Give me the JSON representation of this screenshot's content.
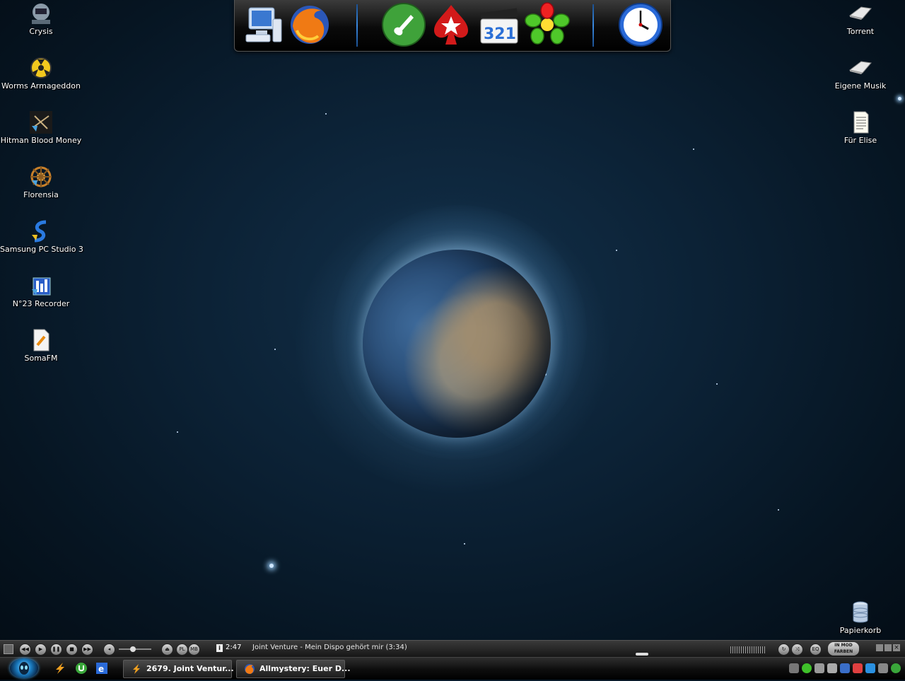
{
  "desktop": {
    "left_icons": [
      {
        "label": "Crysis",
        "icon": "crysis-icon"
      },
      {
        "label": "Worms Armageddon",
        "icon": "worms-icon"
      },
      {
        "label": "Hitman Blood Money",
        "icon": "hitman-icon"
      },
      {
        "label": "Florensia",
        "icon": "florensia-icon"
      },
      {
        "label": "Samsung PC Studio 3",
        "icon": "samsung-icon"
      },
      {
        "label": "N°23 Recorder",
        "icon": "recorder-icon"
      },
      {
        "label": "SomaFM",
        "icon": "somafm-icon"
      }
    ],
    "right_icons": [
      {
        "label": "Torrent",
        "icon": "folder-icon"
      },
      {
        "label": "Eigene Musik",
        "icon": "folder-icon"
      },
      {
        "label": "Für Elise",
        "icon": "text-document-icon"
      }
    ],
    "recycle_bin": {
      "label": "Papierkorb",
      "icon": "recycle-bin-icon"
    }
  },
  "dock": {
    "items": [
      "my-computer-icon",
      "firefox-icon",
      "guitar-icon",
      "pokerstars-icon",
      "media-player-classic-icon",
      "icq-icon",
      "clock-icon"
    ],
    "clock_icon_hands": "4:00"
  },
  "media_player": {
    "time": "2:47",
    "track": "Joint Venture - Mein Dispo gehört mir (3:34)",
    "buttons": {
      "pl": "PL",
      "mb": "MB",
      "eq": "EQ"
    },
    "tags": {
      "top": "IN MOD",
      "bottom": "FARBEN"
    }
  },
  "taskbar": {
    "tasks": [
      {
        "label": "2679. Joint Ventur...",
        "icon": "winamp-icon"
      },
      {
        "label": "Allmystery: Euer D...",
        "icon": "firefox-icon"
      }
    ],
    "quick_launch": [
      "winamp-icon",
      "utorrent-icon",
      "ie-icon"
    ]
  },
  "colors": {
    "accent": "#3a8ae0",
    "space_bg": "#0b2033"
  }
}
